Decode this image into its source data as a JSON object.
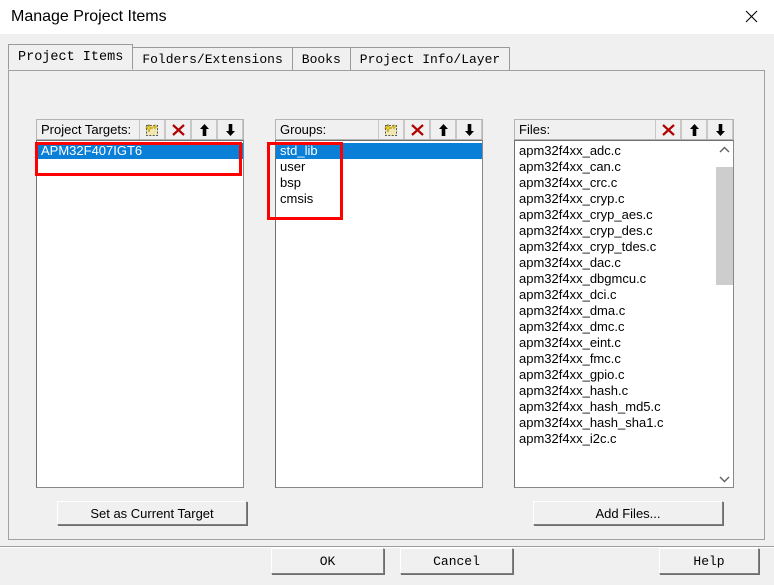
{
  "window": {
    "title": "Manage Project Items",
    "close_icon": "close-icon"
  },
  "tabs": [
    {
      "label": "Project Items",
      "selected": true
    },
    {
      "label": "Folders/Extensions",
      "selected": false
    },
    {
      "label": "Books",
      "selected": false
    },
    {
      "label": "Project Info/Layer",
      "selected": false
    }
  ],
  "panels": {
    "targets": {
      "label": "Project Targets:",
      "tools": [
        "new-item-icon",
        "delete-icon",
        "move-up-icon",
        "move-down-icon"
      ],
      "items": [
        "APM32F407IGT6"
      ],
      "selected_index": 0
    },
    "groups": {
      "label": "Groups:",
      "tools": [
        "new-item-icon",
        "delete-icon",
        "move-up-icon",
        "move-down-icon"
      ],
      "items": [
        "std_lib",
        "user",
        "bsp",
        "cmsis"
      ],
      "selected_index": 0
    },
    "files": {
      "label": "Files:",
      "tools": [
        "delete-icon",
        "move-up-icon",
        "move-down-icon"
      ],
      "items": [
        "apm32f4xx_adc.c",
        "apm32f4xx_can.c",
        "apm32f4xx_crc.c",
        "apm32f4xx_cryp.c",
        "apm32f4xx_cryp_aes.c",
        "apm32f4xx_cryp_des.c",
        "apm32f4xx_cryp_tdes.c",
        "apm32f4xx_dac.c",
        "apm32f4xx_dbgmcu.c",
        "apm32f4xx_dci.c",
        "apm32f4xx_dma.c",
        "apm32f4xx_dmc.c",
        "apm32f4xx_eint.c",
        "apm32f4xx_fmc.c",
        "apm32f4xx_gpio.c",
        "apm32f4xx_hash.c",
        "apm32f4xx_hash_md5.c",
        "apm32f4xx_hash_sha1.c",
        "apm32f4xx_i2c.c"
      ],
      "selected_index": -1,
      "scrollbar": {
        "up_icon": "chevron-up-icon",
        "down_icon": "chevron-down-icon"
      }
    }
  },
  "buttons": {
    "set_current_target": "Set as Current Target",
    "add_files": "Add Files...",
    "ok": "OK",
    "cancel": "Cancel",
    "help": "Help"
  },
  "colors": {
    "selection": "#0a7fd8",
    "annotation": "#ff0000",
    "dialog_bg": "#f0f0f0",
    "delete_icon": "#b00000"
  }
}
